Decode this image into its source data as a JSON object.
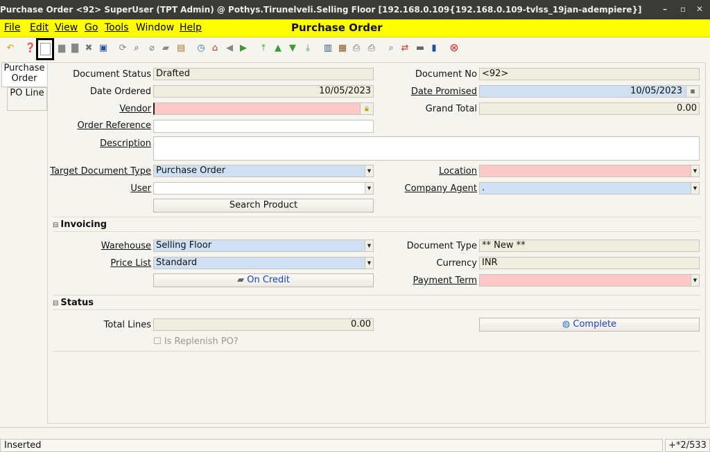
{
  "window": {
    "title": "Purchase Order  <92>  SuperUser (TPT Admin) @ Pothys.Tirunelveli.Selling Floor [192.168.0.109{192.168.0.109-tvlss_19jan-adempiere}]",
    "min": "–",
    "max": "▫",
    "close": "✕"
  },
  "menu": {
    "items": [
      "File",
      "Edit",
      "View",
      "Go",
      "Tools",
      "Window",
      "Help"
    ],
    "window_title": "Purchase Order"
  },
  "toolbar_icons": [
    "undo-icon",
    "help-icon",
    "new-record-icon",
    "copy-record-icon",
    "delete-icon",
    "delete-selection-icon",
    "save-icon",
    "refresh-icon",
    "find-icon",
    "attachment-icon",
    "chat-icon",
    "grid-toggle-icon",
    "history-icon",
    "home-icon",
    "back-icon",
    "forward-icon",
    "first-record-icon",
    "previous-record-icon",
    "next-record-icon",
    "last-record-icon",
    "report-icon",
    "archive-icon",
    "print-preview-icon",
    "print-icon",
    "zoom-across-icon",
    "workflow-icon",
    "requests-icon",
    "product-info-icon",
    "close-window-icon"
  ],
  "tabs": [
    "Purchase Order",
    "PO Line"
  ],
  "form": {
    "document_status": {
      "label": "Document Status",
      "value": "Drafted"
    },
    "document_no": {
      "label": "Document No",
      "value": "<92>"
    },
    "date_ordered": {
      "label": "Date Ordered",
      "value": "10/05/2023"
    },
    "date_promised": {
      "label": "Date Promised",
      "value": "10/05/2023"
    },
    "vendor": {
      "label": "Vendor",
      "value": ""
    },
    "grand_total": {
      "label": "Grand Total",
      "value": "0.00"
    },
    "order_reference": {
      "label": "Order Reference",
      "value": ""
    },
    "description": {
      "label": "Description",
      "value": ""
    },
    "target_doc_type": {
      "label": "Target Document Type",
      "value": "Purchase Order"
    },
    "location": {
      "label": "Location",
      "value": ""
    },
    "user": {
      "label": "User",
      "value": ""
    },
    "company_agent": {
      "label": "Company Agent",
      "value": "."
    },
    "search_product": "Search Product"
  },
  "invoicing": {
    "title": "Invoicing",
    "warehouse": {
      "label": "Warehouse",
      "value": "Selling Floor"
    },
    "document_type": {
      "label": "Document Type",
      "value": "** New **"
    },
    "price_list": {
      "label": "Price List",
      "value": "Standard"
    },
    "currency": {
      "label": "Currency",
      "value": "INR"
    },
    "on_credit": "On Credit",
    "payment_term": {
      "label": "Payment Term",
      "value": ""
    }
  },
  "status_section": {
    "title": "Status",
    "total_lines": {
      "label": "Total Lines",
      "value": "0.00"
    },
    "complete": "Complete",
    "replenish": "Is Replenish PO?"
  },
  "statusbar": {
    "message": "Inserted",
    "count": "+*2/533"
  }
}
